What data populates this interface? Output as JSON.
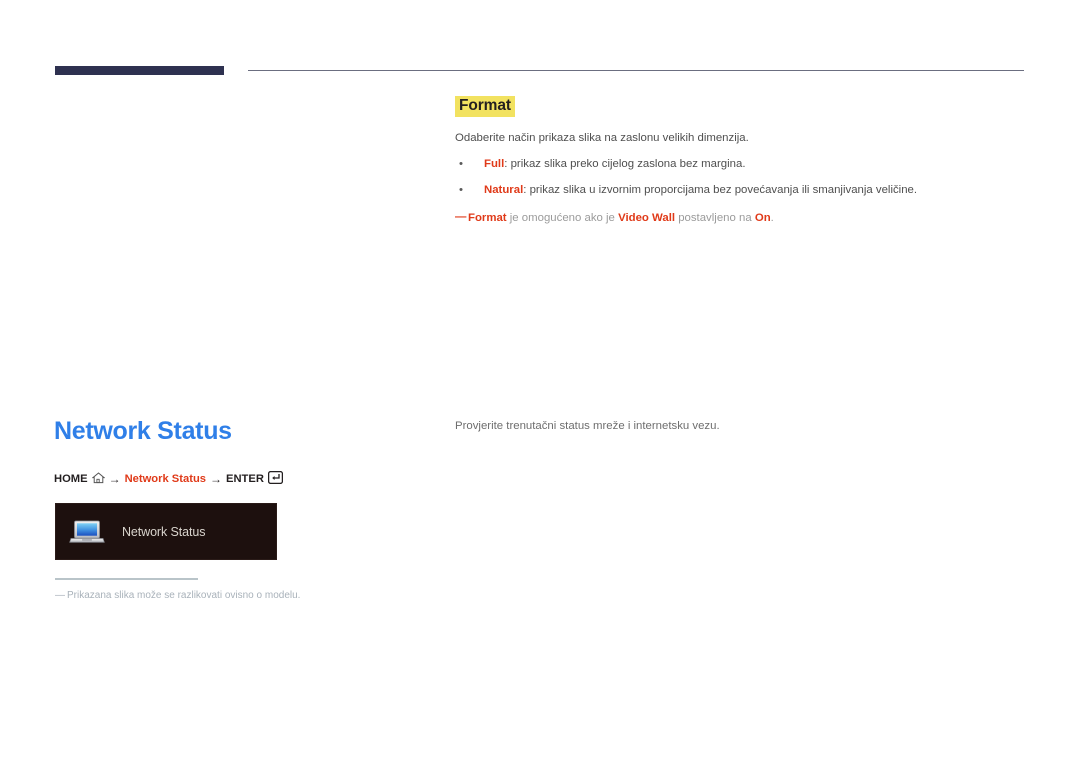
{
  "header": {
    "bar_color": "#2e3150",
    "rule_color": "#6b6e80"
  },
  "format_section": {
    "title": "Format",
    "title_highlight_color": "#f2e260",
    "intro": "Odaberite način prikaza slika na zaslonu velikih dimenzija.",
    "bullets": [
      {
        "bullet_glyph": "•",
        "term": "Full",
        "separator": ": ",
        "text": "prikaz slika preko cijelog zaslona bez margina."
      },
      {
        "bullet_glyph": "•",
        "term": "Natural",
        "separator": ": ",
        "text": "prikaz slika u izvornim proporcijama bez povećavanja ili smanjivanja veličine."
      }
    ],
    "note": {
      "dash": "―",
      "term1": "Format",
      "mid1": " je omogućeno ako je ",
      "term2": "Video Wall",
      "mid2": " postavljeno na ",
      "term3": "On",
      "end": "."
    }
  },
  "network_status_section": {
    "title": "Network Status",
    "title_color": "#2f7fe8",
    "breadcrumb": {
      "home_label": "HOME",
      "home_icon": "home-icon",
      "arrow1": "→",
      "target_label": "Network Status",
      "arrow2": "→",
      "enter_label": "ENTER",
      "enter_icon": "enter-key-icon",
      "accent_color": "#e03a19"
    },
    "osd_panel": {
      "background_color": "#1d100e",
      "icon": "laptop-icon",
      "label": "Network Status",
      "label_color": "#d9d4cd"
    },
    "footnote": {
      "dash": "―",
      "text": "Prikazana slika može se razlikovati ovisno o modelu.",
      "color": "#a9b2ba"
    },
    "description": "Provjerite trenutačni status mreže i internetsku vezu."
  }
}
